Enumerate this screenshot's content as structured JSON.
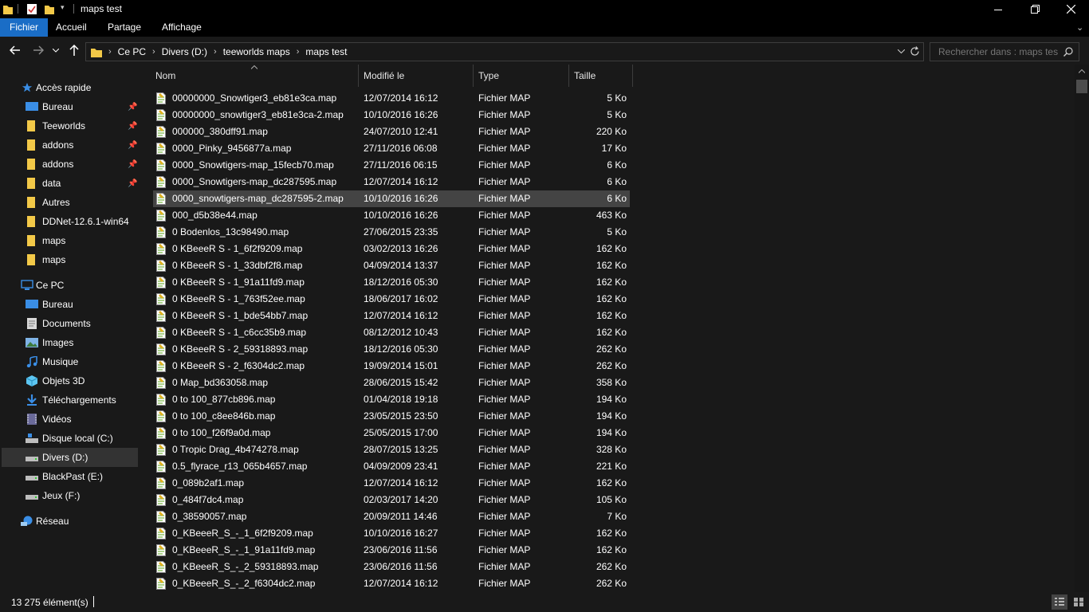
{
  "window": {
    "title": "maps test"
  },
  "ribbon": {
    "tabs": [
      "Fichier",
      "Accueil",
      "Partage",
      "Affichage"
    ]
  },
  "address": {
    "crumbs": [
      "Ce PC",
      "Divers (D:)",
      "teeworlds maps",
      "maps test"
    ],
    "search_placeholder": "Rechercher dans : maps test"
  },
  "nav": {
    "quick_access": "Accès rapide",
    "quick_items": [
      "Bureau",
      "Teeworlds",
      "addons",
      "addons",
      "data",
      "Autres",
      "DDNet-12.6.1-win64",
      "maps",
      "maps"
    ],
    "this_pc": "Ce PC",
    "pc_items": [
      "Bureau",
      "Documents",
      "Images",
      "Musique",
      "Objets 3D",
      "Téléchargements",
      "Vidéos",
      "Disque local (C:)",
      "Divers (D:)",
      "BlackPast (E:)",
      "Jeux (F:)"
    ],
    "network": "Réseau"
  },
  "columns": {
    "name": "Nom",
    "modified": "Modifié le",
    "type": "Type",
    "size": "Taille"
  },
  "files": [
    {
      "name": "00000000_Snowtiger3_eb81e3ca.map",
      "date": "12/07/2014 16:12",
      "type": "Fichier MAP",
      "size": "5 Ko"
    },
    {
      "name": "00000000_snowtiger3_eb81e3ca-2.map",
      "date": "10/10/2016 16:26",
      "type": "Fichier MAP",
      "size": "5 Ko"
    },
    {
      "name": "000000_380dff91.map",
      "date": "24/07/2010 12:41",
      "type": "Fichier MAP",
      "size": "220 Ko"
    },
    {
      "name": "0000_Pinky_9456877a.map",
      "date": "27/11/2016 06:08",
      "type": "Fichier MAP",
      "size": "17 Ko"
    },
    {
      "name": "0000_Snowtigers-map_15fecb70.map",
      "date": "27/11/2016 06:15",
      "type": "Fichier MAP",
      "size": "6 Ko"
    },
    {
      "name": "0000_Snowtigers-map_dc287595.map",
      "date": "12/07/2014 16:12",
      "type": "Fichier MAP",
      "size": "6 Ko"
    },
    {
      "name": "0000_snowtigers-map_dc287595-2.map",
      "date": "10/10/2016 16:26",
      "type": "Fichier MAP",
      "size": "6 Ko"
    },
    {
      "name": "000_d5b38e44.map",
      "date": "10/10/2016 16:26",
      "type": "Fichier MAP",
      "size": "463 Ko"
    },
    {
      "name": "0 Bodenlos_13c98490.map",
      "date": "27/06/2015 23:35",
      "type": "Fichier MAP",
      "size": "5 Ko"
    },
    {
      "name": "0 KBeeeR S - 1_6f2f9209.map",
      "date": "03/02/2013 16:26",
      "type": "Fichier MAP",
      "size": "162 Ko"
    },
    {
      "name": "0 KBeeeR S - 1_33dbf2f8.map",
      "date": "04/09/2014 13:37",
      "type": "Fichier MAP",
      "size": "162 Ko"
    },
    {
      "name": "0 KBeeeR S - 1_91a11fd9.map",
      "date": "18/12/2016 05:30",
      "type": "Fichier MAP",
      "size": "162 Ko"
    },
    {
      "name": "0 KBeeeR S - 1_763f52ee.map",
      "date": "18/06/2017 16:02",
      "type": "Fichier MAP",
      "size": "162 Ko"
    },
    {
      "name": "0 KBeeeR S - 1_bde54bb7.map",
      "date": "12/07/2014 16:12",
      "type": "Fichier MAP",
      "size": "162 Ko"
    },
    {
      "name": "0 KBeeeR S - 1_c6cc35b9.map",
      "date": "08/12/2012 10:43",
      "type": "Fichier MAP",
      "size": "162 Ko"
    },
    {
      "name": "0 KBeeeR S - 2_59318893.map",
      "date": "18/12/2016 05:30",
      "type": "Fichier MAP",
      "size": "262 Ko"
    },
    {
      "name": "0 KBeeeR S - 2_f6304dc2.map",
      "date": "19/09/2014 15:01",
      "type": "Fichier MAP",
      "size": "262 Ko"
    },
    {
      "name": "0 Map_bd363058.map",
      "date": "28/06/2015 15:42",
      "type": "Fichier MAP",
      "size": "358 Ko"
    },
    {
      "name": "0 to 100_877cb896.map",
      "date": "01/04/2018 19:18",
      "type": "Fichier MAP",
      "size": "194 Ko"
    },
    {
      "name": "0 to 100_c8ee846b.map",
      "date": "23/05/2015 23:50",
      "type": "Fichier MAP",
      "size": "194 Ko"
    },
    {
      "name": "0 to 100_f26f9a0d.map",
      "date": "25/05/2015 17:00",
      "type": "Fichier MAP",
      "size": "194 Ko"
    },
    {
      "name": "0 Tropic Drag_4b474278.map",
      "date": "28/07/2015 13:25",
      "type": "Fichier MAP",
      "size": "328 Ko"
    },
    {
      "name": "0.5_flyrace_r13_065b4657.map",
      "date": "04/09/2009 23:41",
      "type": "Fichier MAP",
      "size": "221 Ko"
    },
    {
      "name": "0_089b2af1.map",
      "date": "12/07/2014 16:12",
      "type": "Fichier MAP",
      "size": "162 Ko"
    },
    {
      "name": "0_484f7dc4.map",
      "date": "02/03/2017 14:20",
      "type": "Fichier MAP",
      "size": "105 Ko"
    },
    {
      "name": "0_38590057.map",
      "date": "20/09/2011 14:46",
      "type": "Fichier MAP",
      "size": "7 Ko"
    },
    {
      "name": "0_KBeeeR_S_-_1_6f2f9209.map",
      "date": "10/10/2016 16:27",
      "type": "Fichier MAP",
      "size": "162 Ko"
    },
    {
      "name": "0_KBeeeR_S_-_1_91a11fd9.map",
      "date": "23/06/2016 11:56",
      "type": "Fichier MAP",
      "size": "162 Ko"
    },
    {
      "name": "0_KBeeeR_S_-_2_59318893.map",
      "date": "23/06/2016 11:56",
      "type": "Fichier MAP",
      "size": "262 Ko"
    },
    {
      "name": "0_KBeeeR_S_-_2_f6304dc2.map",
      "date": "12/07/2014 16:12",
      "type": "Fichier MAP",
      "size": "262 Ko"
    }
  ],
  "status": {
    "count": "13 275 élément(s)"
  }
}
